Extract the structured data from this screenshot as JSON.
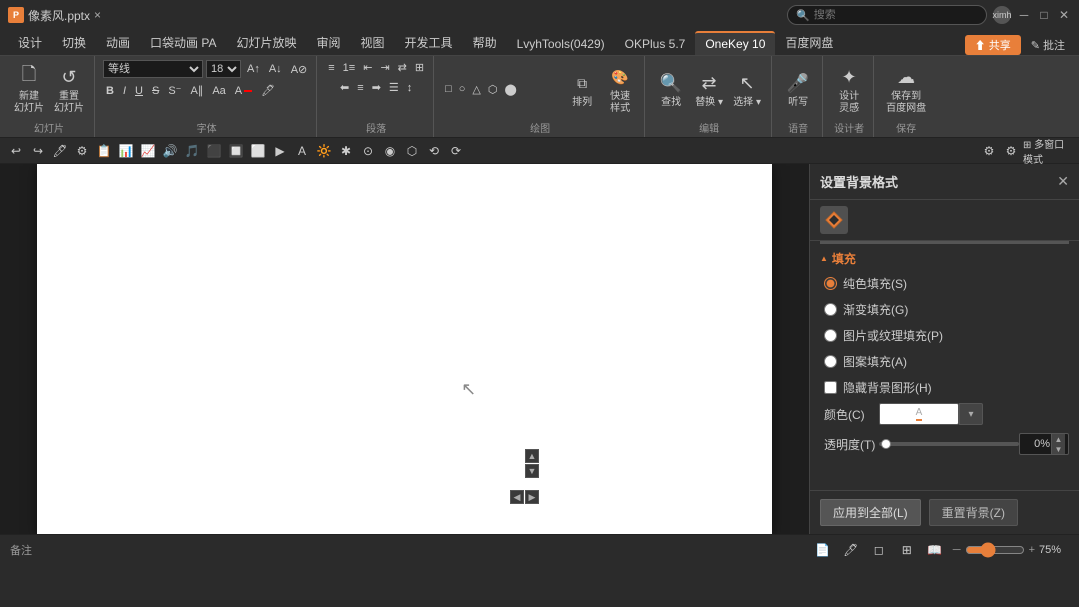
{
  "titlebar": {
    "filename": "像素风.pptx",
    "search_placeholder": "搜索",
    "user": "ximh",
    "window_controls": [
      "minimize",
      "maximize",
      "close"
    ]
  },
  "ribbon_tabs": {
    "tabs": [
      "设计",
      "切换",
      "动画",
      "口袋动画 PA",
      "幻灯片放映",
      "审阅",
      "视图",
      "开发工具",
      "帮助",
      "LvyhTools(0429)",
      "OKPlus 5.7",
      "OneKey 10",
      "百度网盘"
    ],
    "active_tab": "设计",
    "share_btn": "共享",
    "comment_btn": "批注"
  },
  "ribbon": {
    "groups": [
      {
        "name": "幻灯片",
        "buttons": [
          "新建\n幻灯片",
          "重置\n幻灯片"
        ]
      }
    ]
  },
  "toolbar2": {
    "items": [
      "undo",
      "redo",
      "format-painter"
    ]
  },
  "format_panel": {
    "title": "设置背景格式",
    "close_icon": "✕",
    "fill_section": "填充",
    "fill_options": [
      {
        "label": "纯色填充(S)",
        "value": "solid",
        "checked": true
      },
      {
        "label": "渐变填充(G)",
        "value": "gradient",
        "checked": false
      },
      {
        "label": "图片或纹理填充(P)",
        "value": "picture",
        "checked": false
      },
      {
        "label": "图案填充(A)",
        "value": "pattern",
        "checked": false
      }
    ],
    "hide_bg_checkbox": "隐藏背景图形(H)",
    "color_label": "颜色(C)",
    "transparency_label": "透明度(T)",
    "transparency_value": "0%",
    "apply_all_btn": "应用到全部(L)",
    "reset_btn": "重置背景(Z)"
  },
  "status_bar": {
    "left": "备注",
    "slide_icon": "幻灯片",
    "comment_icon": "批注",
    "view_icons": [
      "普通",
      "大纲",
      "幻灯片浏览",
      "阅读视图"
    ],
    "zoom": "75%"
  }
}
